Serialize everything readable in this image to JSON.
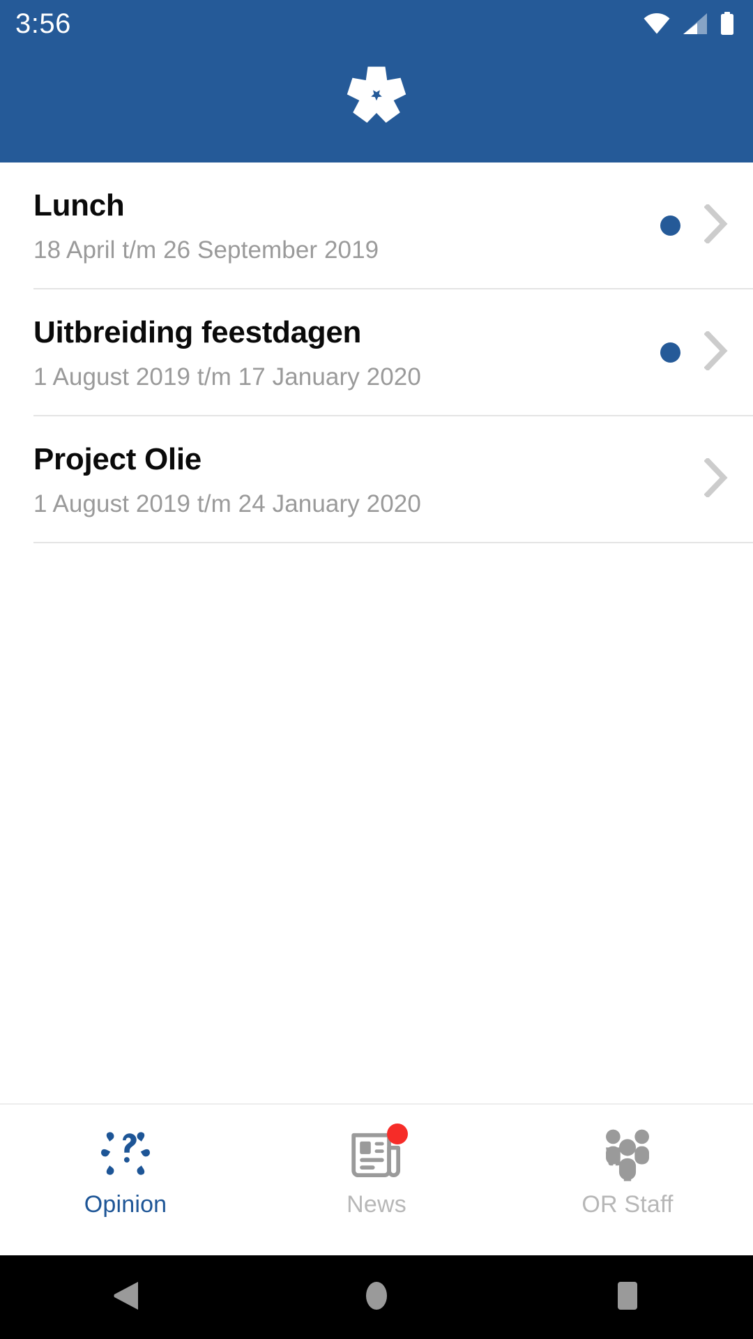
{
  "status_bar": {
    "time": "3:56",
    "icons": [
      "wifi-icon",
      "cellular-signal-icon",
      "battery-icon"
    ]
  },
  "header": {
    "background_color": "#255a98",
    "logo_icon": "pinwheel-logo-icon"
  },
  "list": {
    "items": [
      {
        "title": "Lunch",
        "subtitle": "18 April t/m 26 September 2019",
        "has_unread_dot": true,
        "chevron_icon": "chevron-right-icon"
      },
      {
        "title": "Uitbreiding feestdagen",
        "subtitle": "1 August 2019 t/m 17 January 2020",
        "has_unread_dot": true,
        "chevron_icon": "chevron-right-icon"
      },
      {
        "title": "Project Olie",
        "subtitle": "1 August 2019 t/m 24 January 2020",
        "has_unread_dot": false,
        "chevron_icon": "chevron-right-icon"
      }
    ],
    "unread_dot_color": "#255a98",
    "chevron_color": "#cccccc"
  },
  "tabbar": {
    "active_color": "#1d5596",
    "inactive_color": "#b7b7b7",
    "badge_color": "#f62c28",
    "tabs": [
      {
        "label": "Opinion",
        "icon": "opinion-question-icon",
        "active": true,
        "badge": false
      },
      {
        "label": "News",
        "icon": "newspaper-icon",
        "active": false,
        "badge": true
      },
      {
        "label": "OR Staff",
        "icon": "people-group-icon",
        "active": false,
        "badge": false
      }
    ]
  },
  "android_nav": {
    "buttons": [
      {
        "name": "back-button",
        "icon": "triangle-back-icon"
      },
      {
        "name": "home-button",
        "icon": "circle-home-icon"
      },
      {
        "name": "recents-button",
        "icon": "square-recents-icon"
      }
    ],
    "icon_color": "#9a9a9a",
    "background_color": "#000000"
  }
}
